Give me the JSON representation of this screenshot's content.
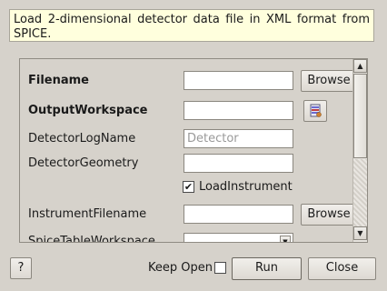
{
  "description": "Load 2-dimensional detector data file in XML format from SPICE.",
  "properties": [
    {
      "label": "Filename",
      "bold": true,
      "value": "",
      "button": "Browse"
    },
    {
      "label": "OutputWorkspace",
      "bold": true,
      "value": ""
    },
    {
      "label": "DetectorLogName",
      "bold": false,
      "placeholder": "Detector"
    },
    {
      "label": "DetectorGeometry",
      "bold": false,
      "value": ""
    },
    {
      "label": "LoadInstrument",
      "checked": true
    },
    {
      "label": "InstrumentFilename",
      "bold": false,
      "value": "",
      "button": "Browse"
    },
    {
      "label": "SpiceTableWorkspace",
      "bold": false,
      "value": ""
    }
  ],
  "footer": {
    "help_label": "?",
    "keep_open_label": "Keep Open",
    "keep_open_checked": false,
    "run_label": "Run",
    "close_label": "Close"
  },
  "icons": {
    "checkmark": "✔",
    "scroll_up": "▲",
    "scroll_down": "▼",
    "combo_arrow": "▼"
  }
}
